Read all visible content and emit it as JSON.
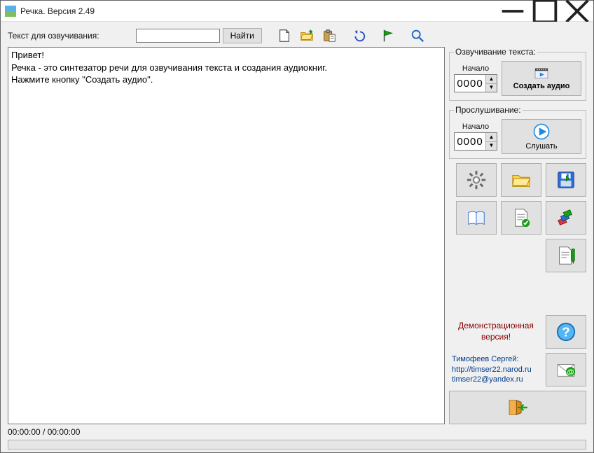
{
  "window": {
    "title": "Речка. Версия 2.49"
  },
  "toolbar": {
    "label": "Текст для озвучивания:",
    "search_value": "",
    "find_label": "Найти"
  },
  "editor": {
    "text": "Привет!\nРечка - это синтезатор речи для озвучивания текста и создания аудиокниг.\nНажмите кнопку \"Создать аудио\"."
  },
  "right": {
    "group1": {
      "legend": "Озвучивание текста:",
      "start_label": "Начало",
      "start_value": "0000",
      "button_label": "Создать аудио"
    },
    "group2": {
      "legend": "Прослушивание:",
      "start_label": "Начало",
      "start_value": "0000",
      "button_label": "Слушать"
    },
    "demo": {
      "line": "Демонстрационная версия!"
    },
    "contact": {
      "name": "Тимофеев Сергей:",
      "url": "http://timser22.narod.ru",
      "email": "timser22@yandex.ru"
    }
  },
  "status": {
    "time": "00:00:00 / 00:00:00"
  }
}
